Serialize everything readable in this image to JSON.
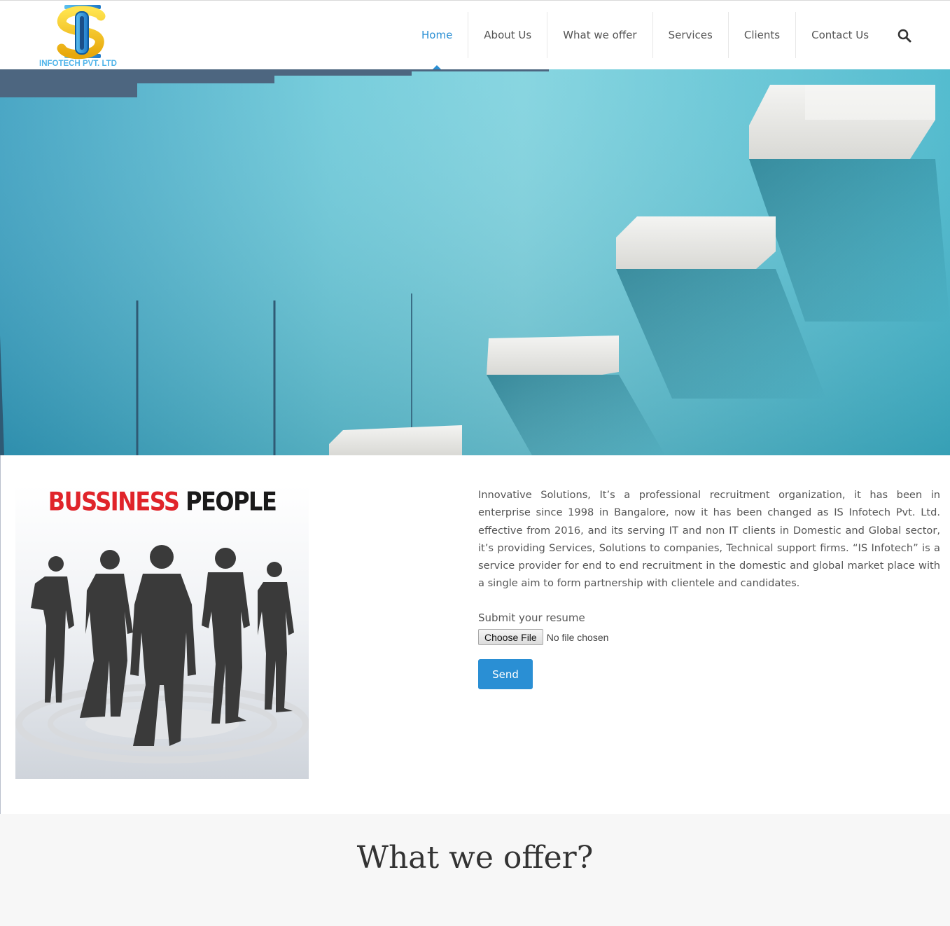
{
  "brand": {
    "logo_text": "INFOTECH PVT. LTD",
    "logo_monogram": "IS",
    "colors": {
      "blue": "#2a8fd4",
      "logo_yellow": "#f5c518",
      "logo_blue": "#3fa9e6"
    }
  },
  "nav": {
    "items": [
      {
        "label": "Home",
        "active": true
      },
      {
        "label": "About Us"
      },
      {
        "label": "What we offer"
      },
      {
        "label": "Services"
      },
      {
        "label": "Clients"
      },
      {
        "label": "Contact Us"
      }
    ],
    "search_icon": "search-icon"
  },
  "hero": {
    "background": "#5ec5d6"
  },
  "business_image": {
    "word1": "BUSSINESS",
    "word2": "PEOPLE"
  },
  "intro": {
    "text": "Innovative Solutions, It’s a professional recruitment organization, it has been in enterprise since 1998 in Bangalore, now it has been changed as IS Infotech Pvt. Ltd. effective from 2016, and its serving IT and non IT clients in Domestic and Global sector, it’s providing Services, Solutions to companies, Technical support firms. “IS Infotech” is a service provider for end to end recruitment in the domestic and global market place with a single aim to form partnership with clientele and candidates."
  },
  "resume": {
    "label": "Submit your resume",
    "file_button": "Choose File",
    "file_status": "No file chosen",
    "send": "Send"
  },
  "offer": {
    "title": "What we offer?"
  }
}
